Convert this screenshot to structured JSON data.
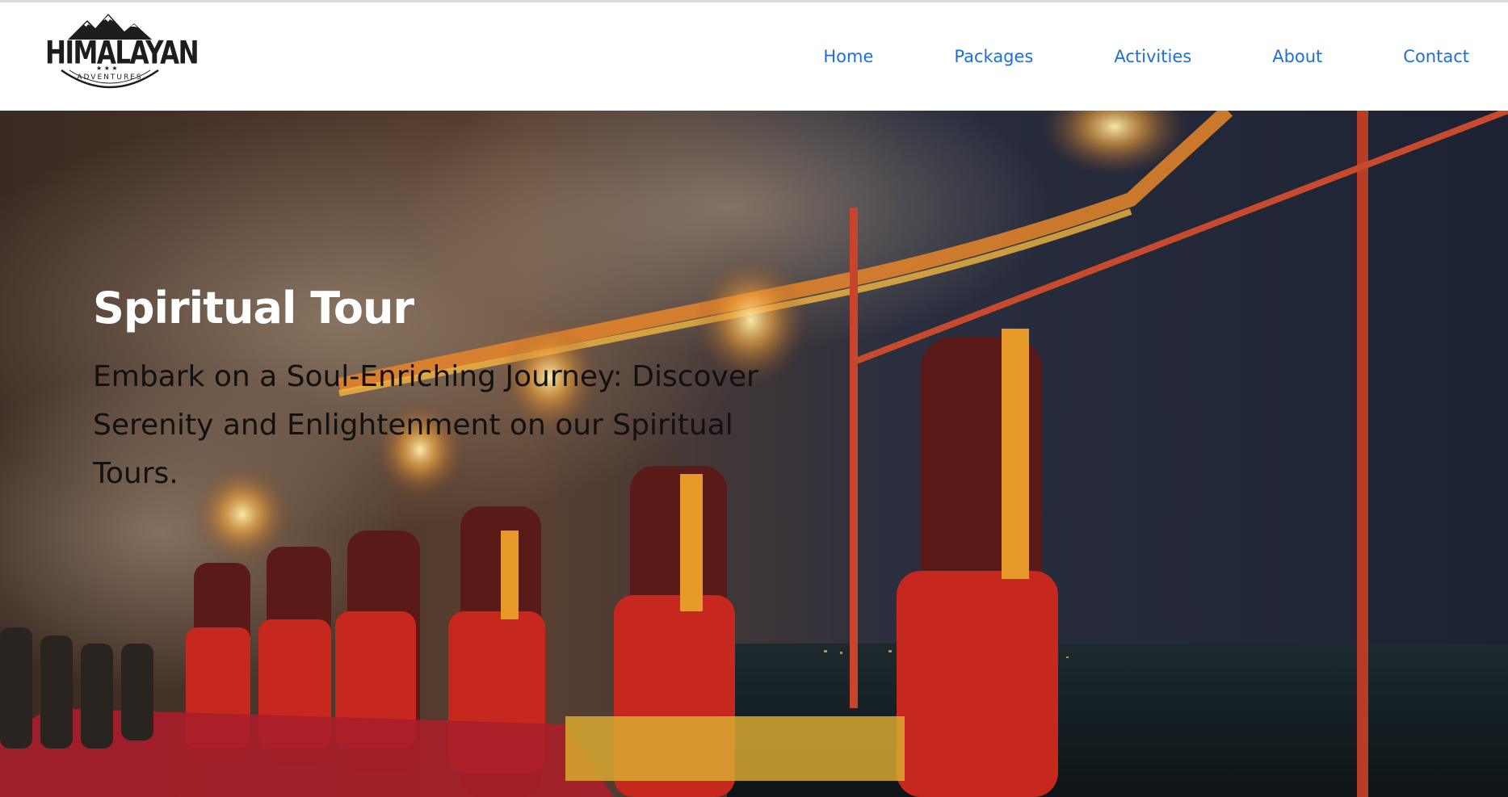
{
  "brand": {
    "name": "HIMALAYAN",
    "tagline": "ADVENTURES"
  },
  "nav": {
    "items": [
      {
        "label": "Home"
      },
      {
        "label": "Packages"
      },
      {
        "label": "Activities"
      },
      {
        "label": "About"
      },
      {
        "label": "Contact"
      }
    ]
  },
  "hero": {
    "title": "Spiritual Tour",
    "description": "Embark on a Soul-Enriching Journey: Discover Serenity and Enlightenment on our Spiritual Tours."
  },
  "colors": {
    "nav_link": "#1f6fd6",
    "title": "#ffffff",
    "description": "#111111"
  }
}
